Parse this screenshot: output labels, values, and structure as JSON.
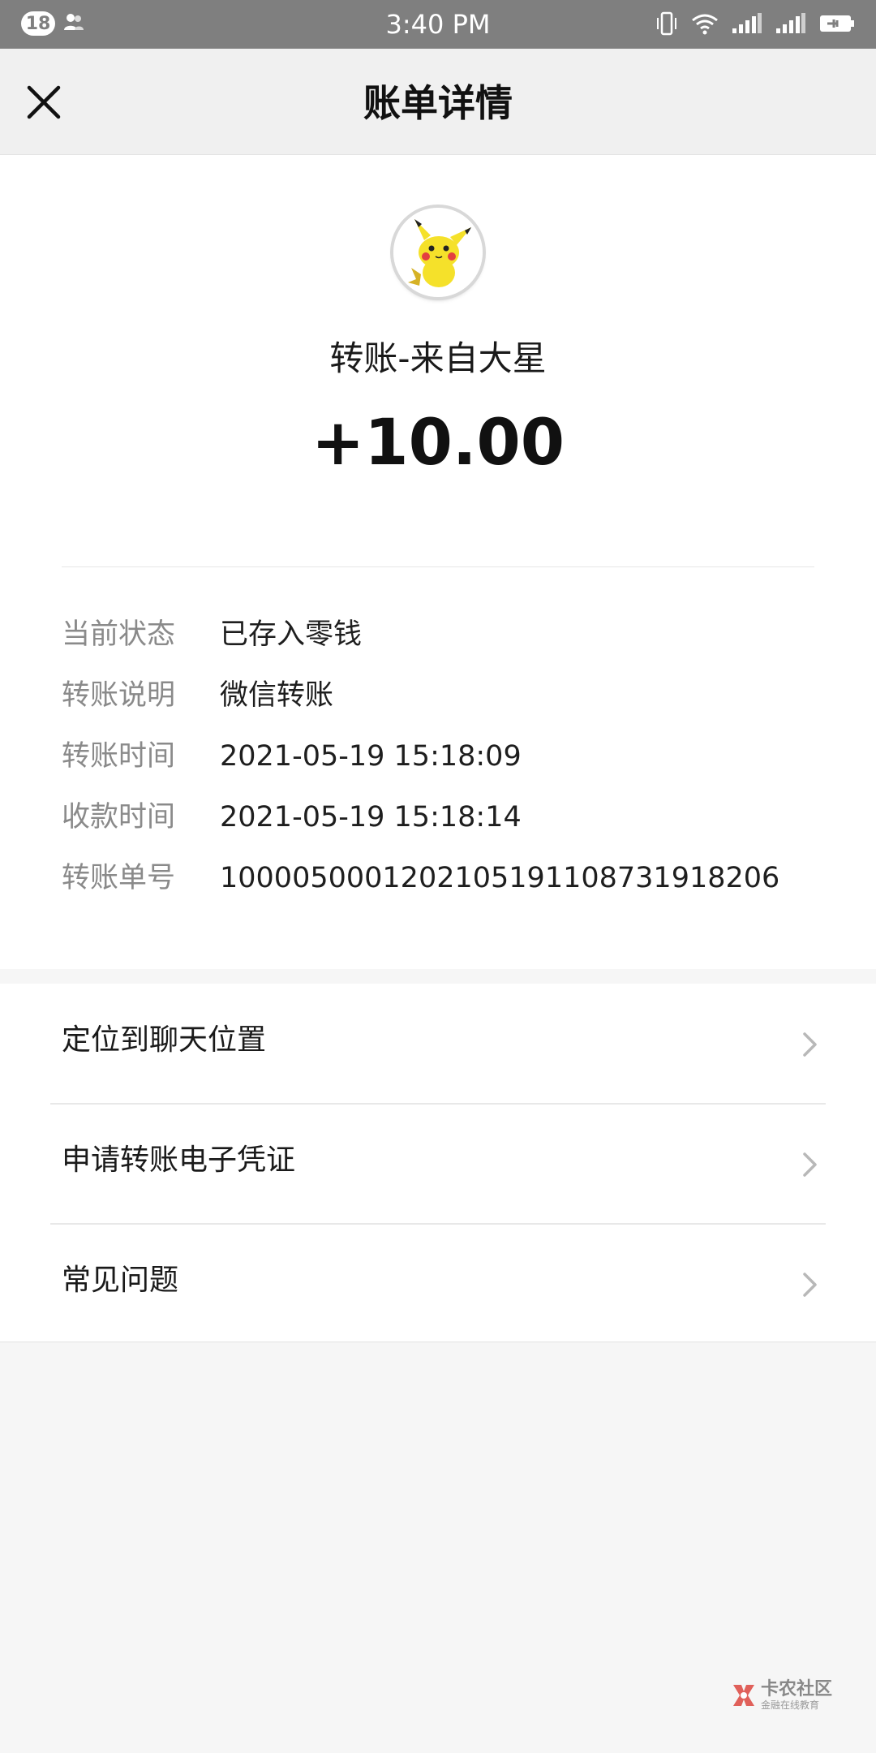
{
  "status_bar": {
    "notification_count": "18",
    "time": "3:40 PM",
    "icons": [
      "people-icon",
      "vibrate-icon",
      "wifi-icon",
      "signal-icon",
      "signal-2-icon",
      "battery-charging-icon"
    ]
  },
  "header": {
    "title": "账单详情",
    "close_icon": "close-icon"
  },
  "transaction": {
    "avatar_icon": "avatar-pikachu",
    "title": "转账-来自大星",
    "amount": "+10.00",
    "details": [
      {
        "label": "当前状态",
        "value": "已存入零钱"
      },
      {
        "label": "转账说明",
        "value": "微信转账"
      },
      {
        "label": "转账时间",
        "value": "2021-05-19 15:18:09"
      },
      {
        "label": "收款时间",
        "value": "2021-05-19 15:18:14"
      },
      {
        "label": "转账单号",
        "value": "1000050001202105191108731918206"
      }
    ]
  },
  "menu": {
    "items": [
      {
        "label": "定位到聊天位置"
      },
      {
        "label": "申请转账电子凭证"
      },
      {
        "label": "常见问题"
      }
    ]
  },
  "watermark": {
    "title": "卡农社区",
    "subtitle": "金融在线教育"
  },
  "colors": {
    "status_bar": "#7f7f7f",
    "header_bg": "#f0f0f0",
    "page_bg": "#f6f6f6",
    "label_gray": "#8a8a8a"
  }
}
